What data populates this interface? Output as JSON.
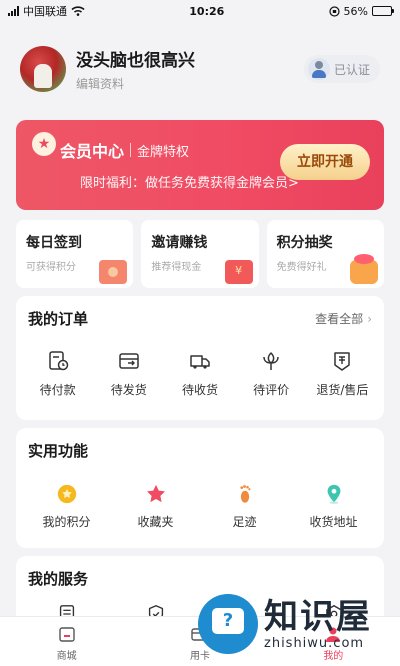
{
  "status_bar": {
    "carrier": "中国联通",
    "time": "10:26",
    "battery_percent": "56%",
    "battery_level": 0.56
  },
  "profile": {
    "name": "没头脑也很高兴",
    "edit_label": "编辑资料",
    "verified_label": "已认证"
  },
  "vip": {
    "title": "会员中心",
    "subtitle": "金牌特权",
    "description": "限时福利：做任务免费获得金牌会员>",
    "button_label": "立即开通"
  },
  "quick_cards": [
    {
      "title": "每日签到",
      "subtitle": "可获得积分",
      "icon": "red-envelope-icon"
    },
    {
      "title": "邀请赚钱",
      "subtitle": "推荐得现金",
      "icon": "money-envelope-icon"
    },
    {
      "title": "积分抽奖",
      "subtitle": "免费得好礼",
      "icon": "gift-box-icon"
    }
  ],
  "orders": {
    "title": "我的订单",
    "view_all": "查看全部",
    "items": [
      {
        "label": "待付款",
        "icon": "payment-pending-icon"
      },
      {
        "label": "待发货",
        "icon": "shipping-pending-icon"
      },
      {
        "label": "待收货",
        "icon": "delivery-truck-icon"
      },
      {
        "label": "待评价",
        "icon": "review-flower-icon"
      },
      {
        "label": "退货/售后",
        "icon": "after-sales-icon"
      }
    ]
  },
  "tools": {
    "title": "实用功能",
    "items": [
      {
        "label": "我的积分",
        "icon": "points-coin-icon",
        "color": "#f5b91f"
      },
      {
        "label": "收藏夹",
        "icon": "star-icon",
        "color": "#f04b63"
      },
      {
        "label": "足迹",
        "icon": "footprint-icon",
        "color": "#f08a3c"
      },
      {
        "label": "收货地址",
        "icon": "location-pin-icon",
        "color": "#3cc6b0"
      }
    ]
  },
  "services": {
    "title": "我的服务",
    "icons": [
      "document-icon",
      "shield-icon",
      "headset-icon",
      "settings-icon"
    ]
  },
  "tab_bar": {
    "tabs": [
      {
        "label": "商城",
        "icon": "shop-icon",
        "active": false
      },
      {
        "label": "用卡",
        "icon": "card-icon",
        "active": false
      },
      {
        "label": "我的",
        "icon": "profile-icon",
        "active": true
      }
    ]
  },
  "watermark": {
    "text_cn": "知识屋",
    "text_en": "zhishiwu.com"
  },
  "colors": {
    "accent": "#e9405c",
    "vip_gold_text": "#9a4a0a",
    "background": "#f3f3f5"
  }
}
